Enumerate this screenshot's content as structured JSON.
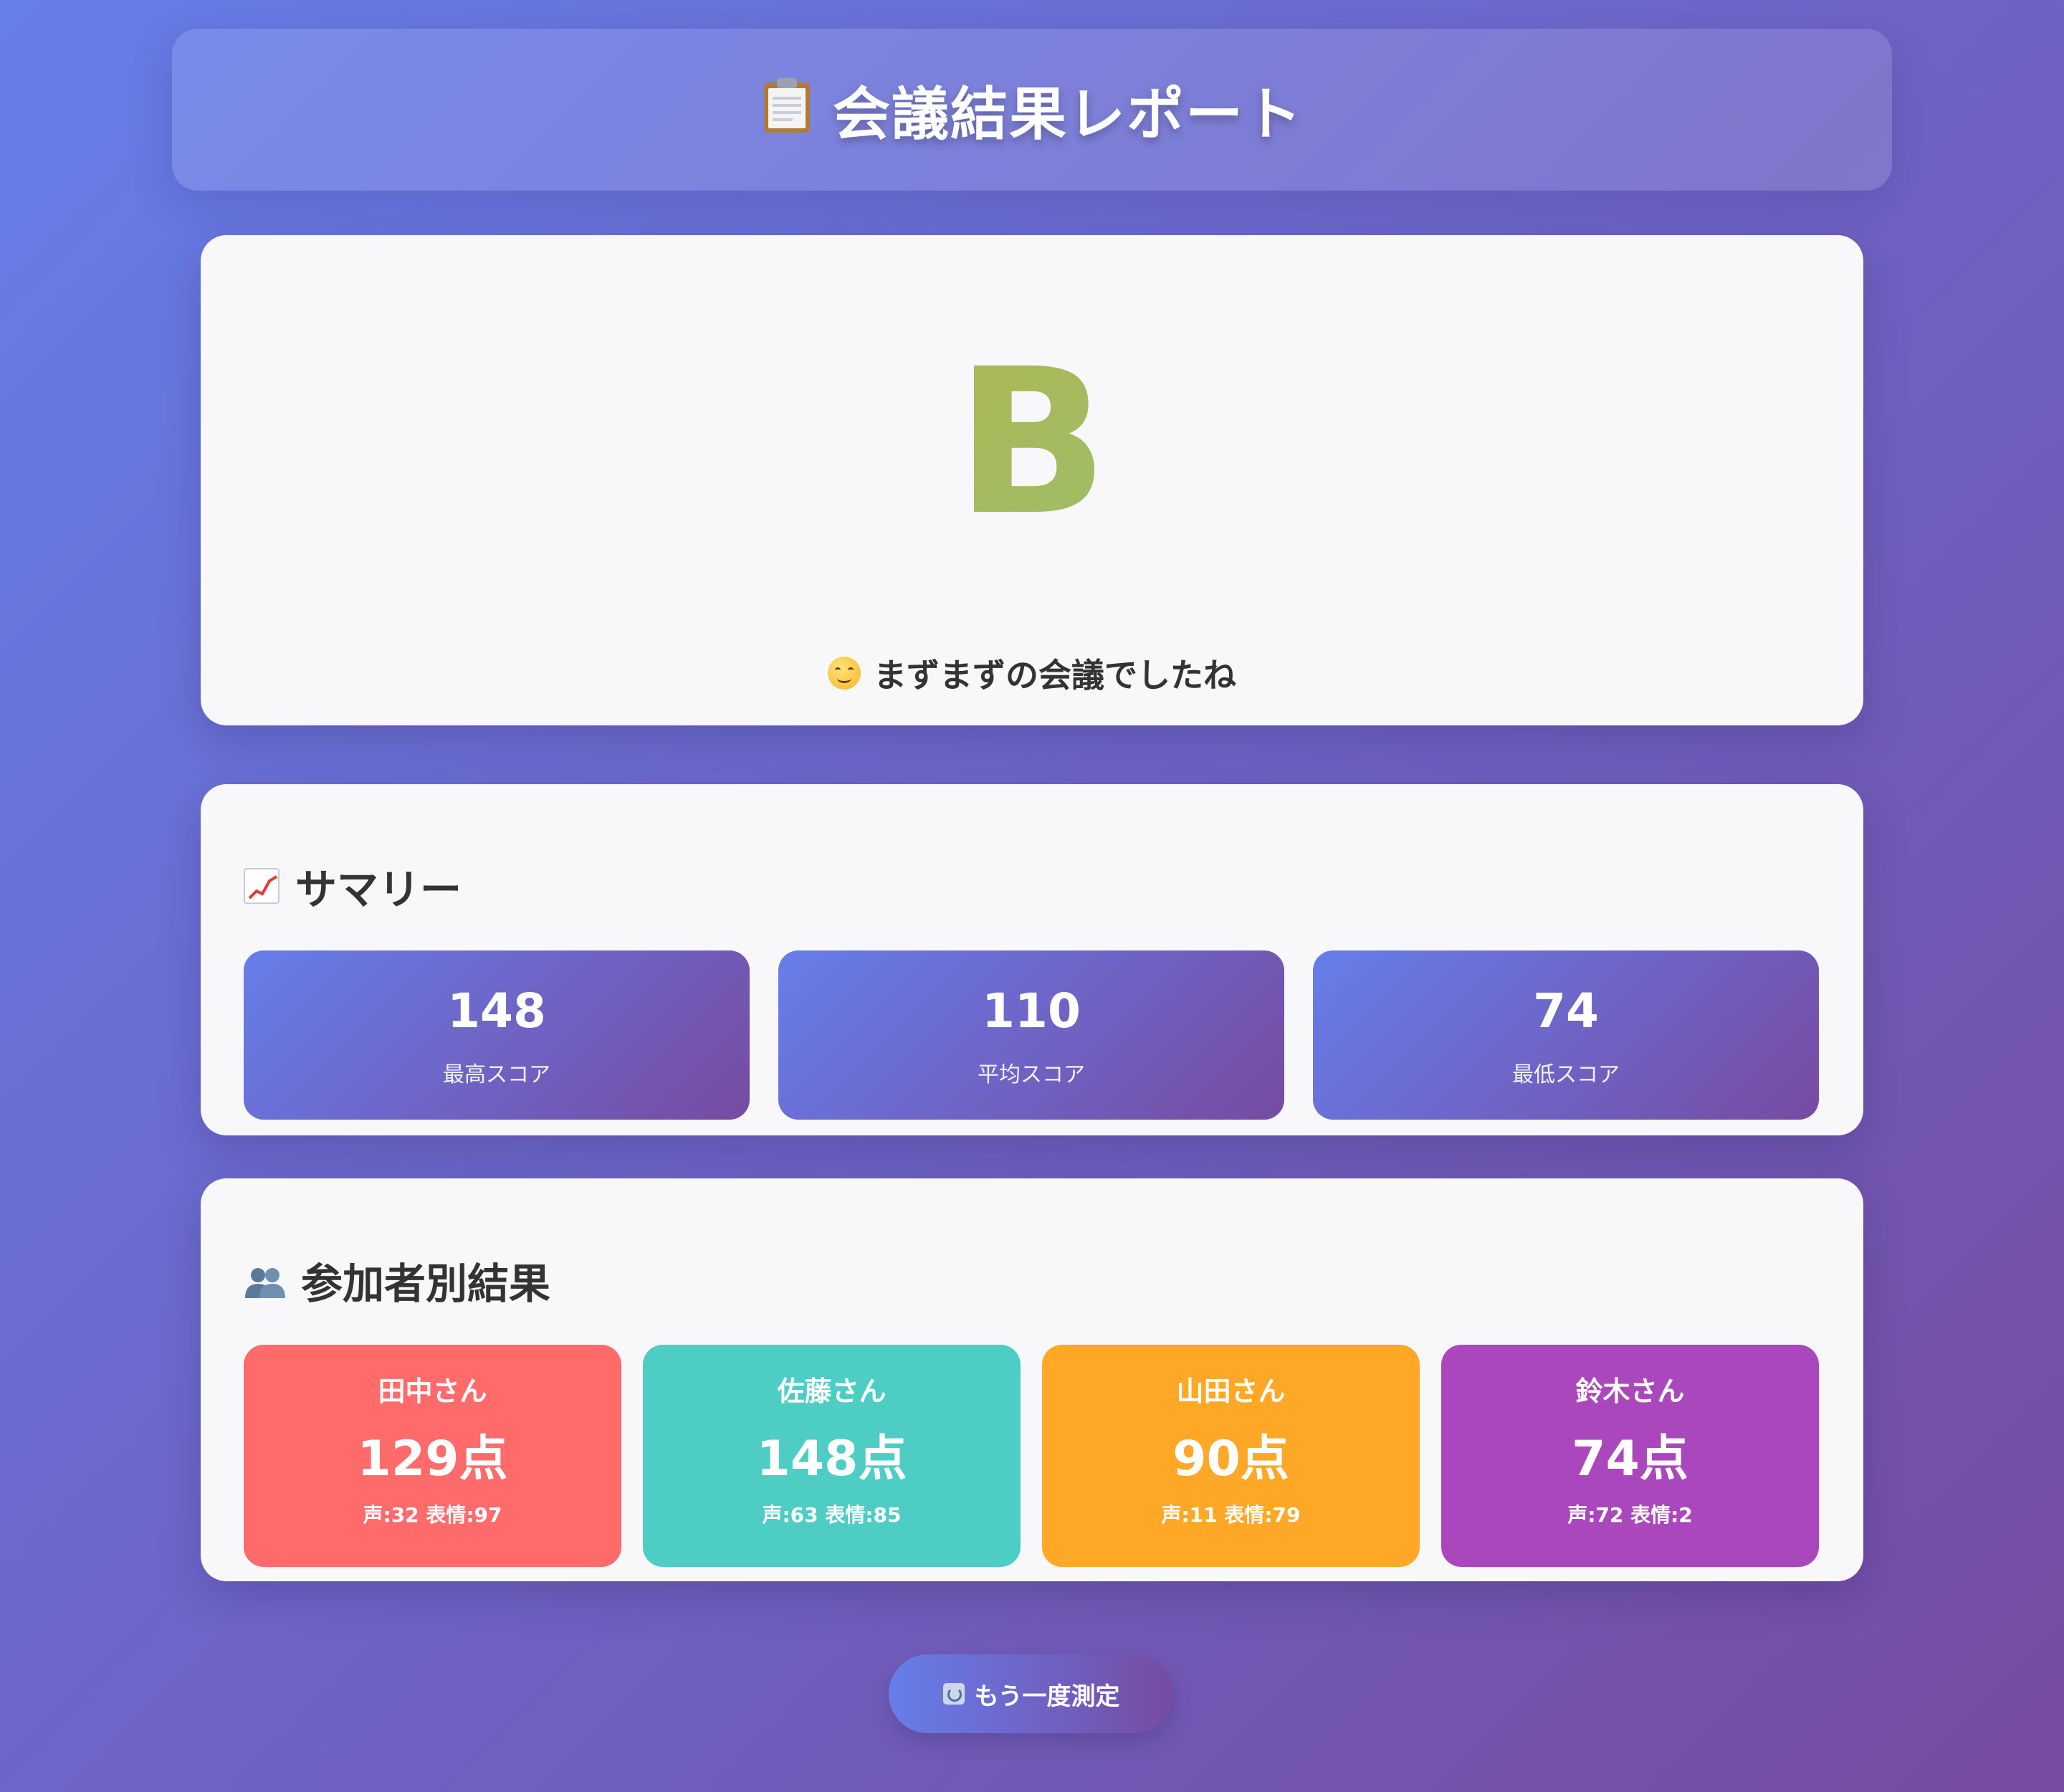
{
  "header": {
    "icon": "clipboard-icon",
    "title": "会議結果レポート"
  },
  "grade": {
    "letter": "B",
    "icon": "smile-icon",
    "message": "まずまずの会議でしたね"
  },
  "summary": {
    "icon": "chart-increasing-icon",
    "title": "サマリー",
    "stats": [
      {
        "value": "148",
        "label": "最高スコア"
      },
      {
        "value": "110",
        "label": "平均スコア"
      },
      {
        "value": "74",
        "label": "最低スコア"
      }
    ]
  },
  "participants": {
    "icon": "people-icon",
    "title": "参加者別結果",
    "items": [
      {
        "name": "田中さん",
        "score": "129点",
        "detail": "声:32 表情:97",
        "color": "#ff6b6b"
      },
      {
        "name": "佐藤さん",
        "score": "148点",
        "detail": "声:63 表情:85",
        "color": "#4ecdc4"
      },
      {
        "name": "山田さん",
        "score": "90点",
        "detail": "声:11 表情:79",
        "color": "#ffa726"
      },
      {
        "name": "鈴木さん",
        "score": "74点",
        "detail": "声:72 表情:2",
        "color": "#ab47bc"
      }
    ]
  },
  "retry_button": {
    "icon": "refresh-icon",
    "label": "もう一度測定"
  },
  "colors": {
    "background_start": "#667eea",
    "background_end": "#764ba2"
  }
}
